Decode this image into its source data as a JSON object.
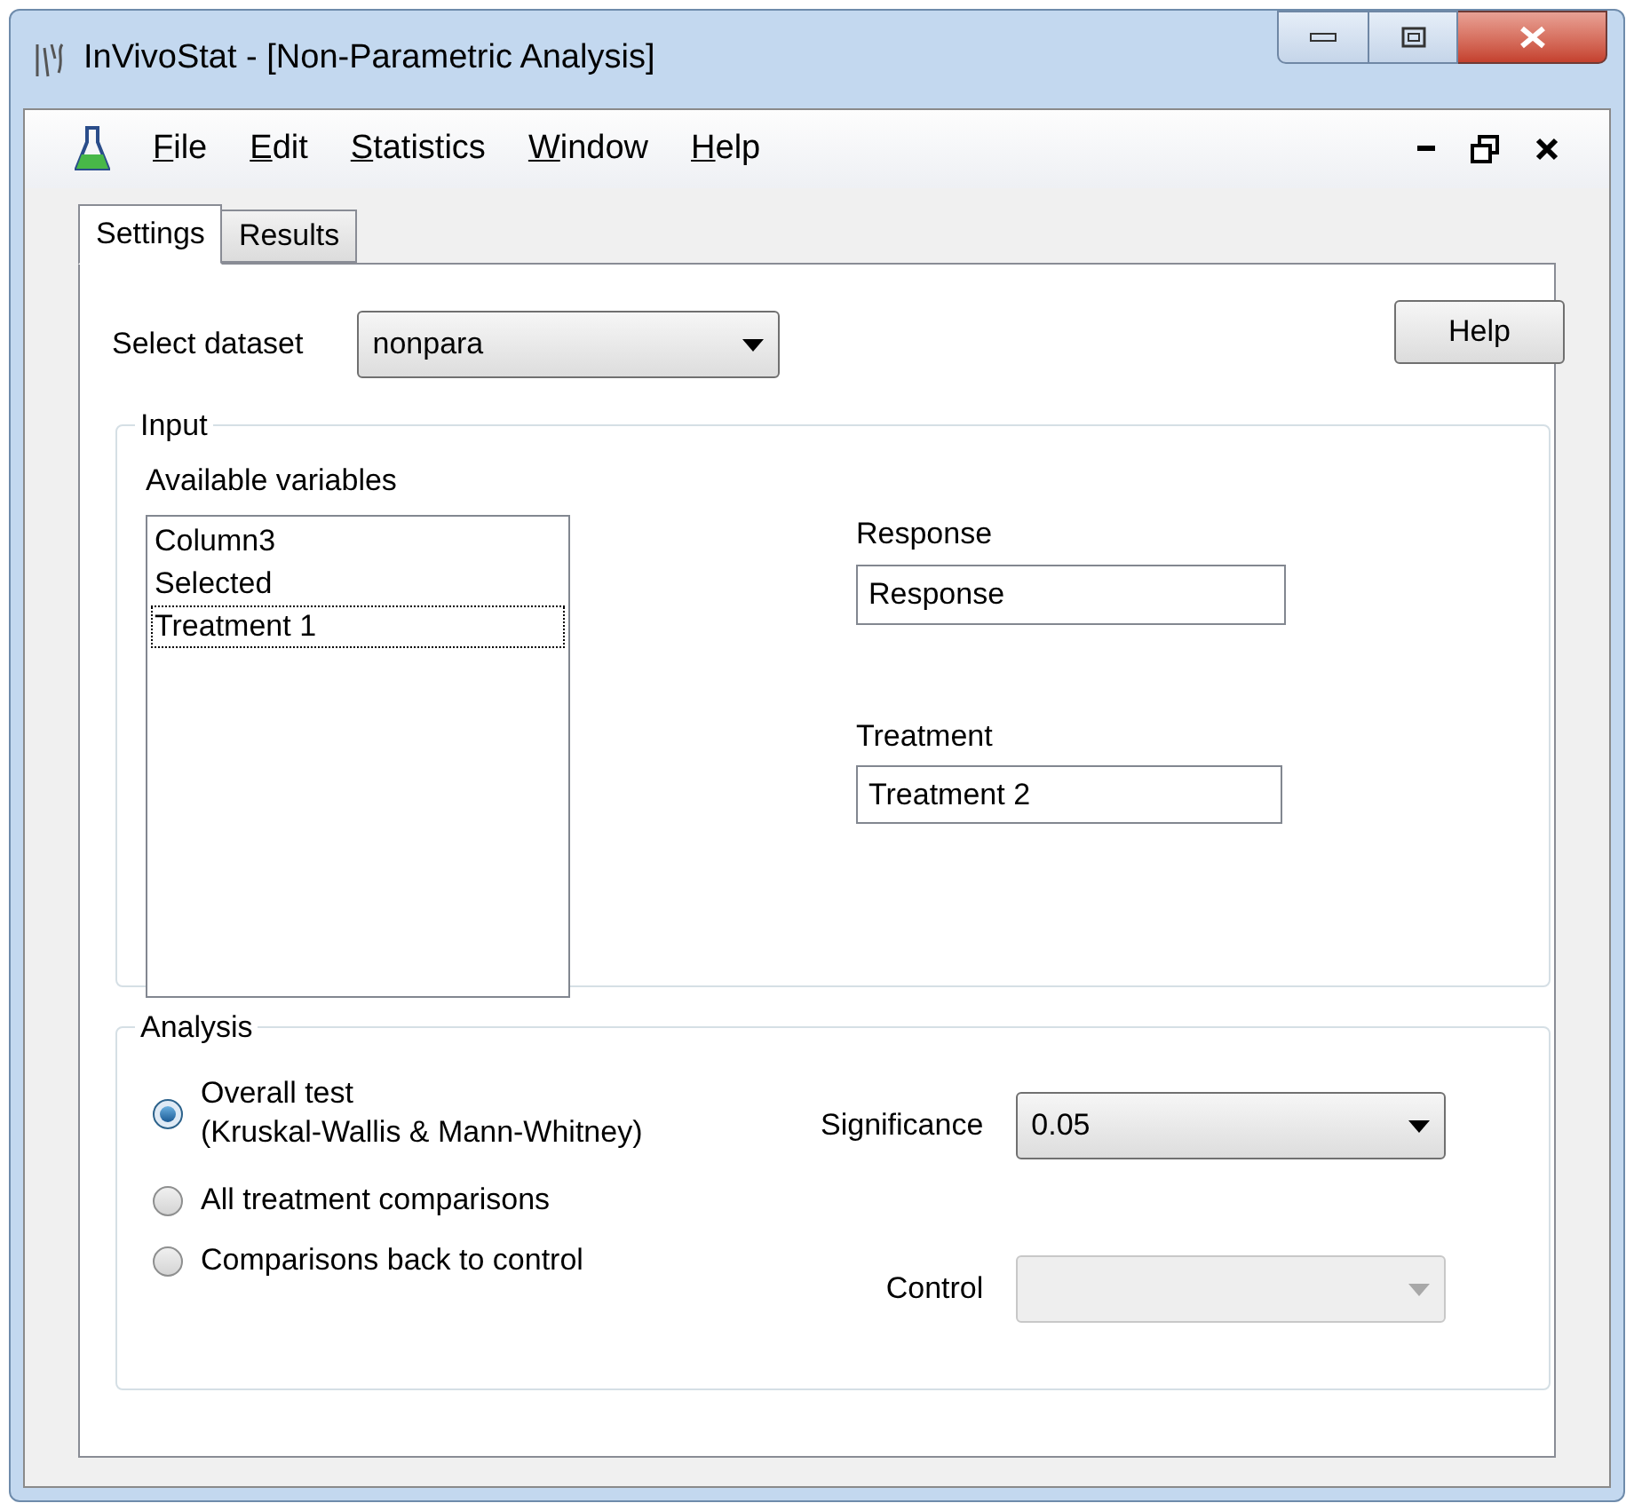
{
  "window": {
    "title": "InVivoStat - [Non-Parametric Analysis]"
  },
  "menu": [
    {
      "label": "File"
    },
    {
      "label": "Edit"
    },
    {
      "label": "Statistics"
    },
    {
      "label": "Window"
    },
    {
      "label": "Help"
    }
  ],
  "tabs": [
    {
      "label": "Settings",
      "selected": true
    },
    {
      "label": "Results",
      "selected": false
    }
  ],
  "dataset": {
    "label": "Select dataset",
    "value": "nonpara"
  },
  "help_button": "Help",
  "input": {
    "title": "Input",
    "available_label": "Available variables",
    "variables": [
      {
        "label": "Column3",
        "focused": false
      },
      {
        "label": "Selected",
        "focused": false
      },
      {
        "label": "Treatment 1",
        "focused": true
      }
    ],
    "response": {
      "label": "Response",
      "value": "Response"
    },
    "treatment": {
      "label": "Treatment",
      "value": "Treatment 2"
    }
  },
  "analysis": {
    "title": "Analysis",
    "options": [
      {
        "label": "Overall test",
        "note": "(Kruskal-Wallis & Mann-Whitney)",
        "selected": true
      },
      {
        "label": "All treatment comparisons",
        "selected": false
      },
      {
        "label": "Comparisons back to control",
        "selected": false
      }
    ],
    "significance": {
      "label": "Significance",
      "value": "0.05",
      "disabled": false
    },
    "control": {
      "label": "Control",
      "disabled": true
    }
  }
}
